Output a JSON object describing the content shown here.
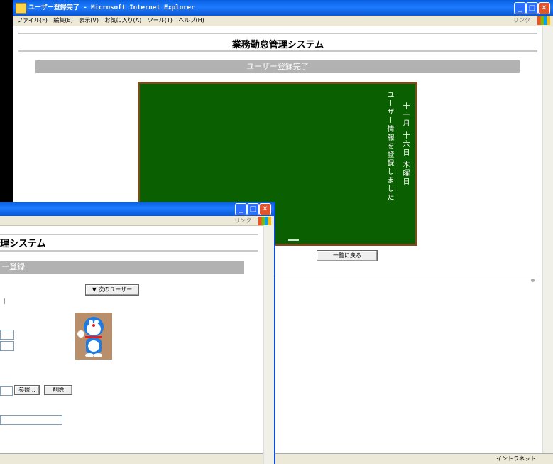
{
  "main_window": {
    "title": "ユーザー登録完了 - Microsoft Internet Explorer",
    "menu": [
      "ファイル(F)",
      "編集(E)",
      "表示(V)",
      "お気に入り(A)",
      "ツール(T)",
      "ヘルプ(H)"
    ],
    "links_label": "リンク",
    "system_title": "業務勤怠管理システム",
    "section_title": "ユーザー登録完了",
    "chalkboard": {
      "message": "ユーザー情報を登録しました",
      "date": "十一月 十六日 木曜日"
    },
    "back_button": "一覧に戻る",
    "status_zone": "イントラネット"
  },
  "front_window": {
    "links_label": "リンク",
    "system_title_partial": "理システム",
    "section_title_partial": "ー登録",
    "next_user_button": "▼ 次のユーザー",
    "browse_button": "参照...",
    "delete_button": "削除"
  }
}
